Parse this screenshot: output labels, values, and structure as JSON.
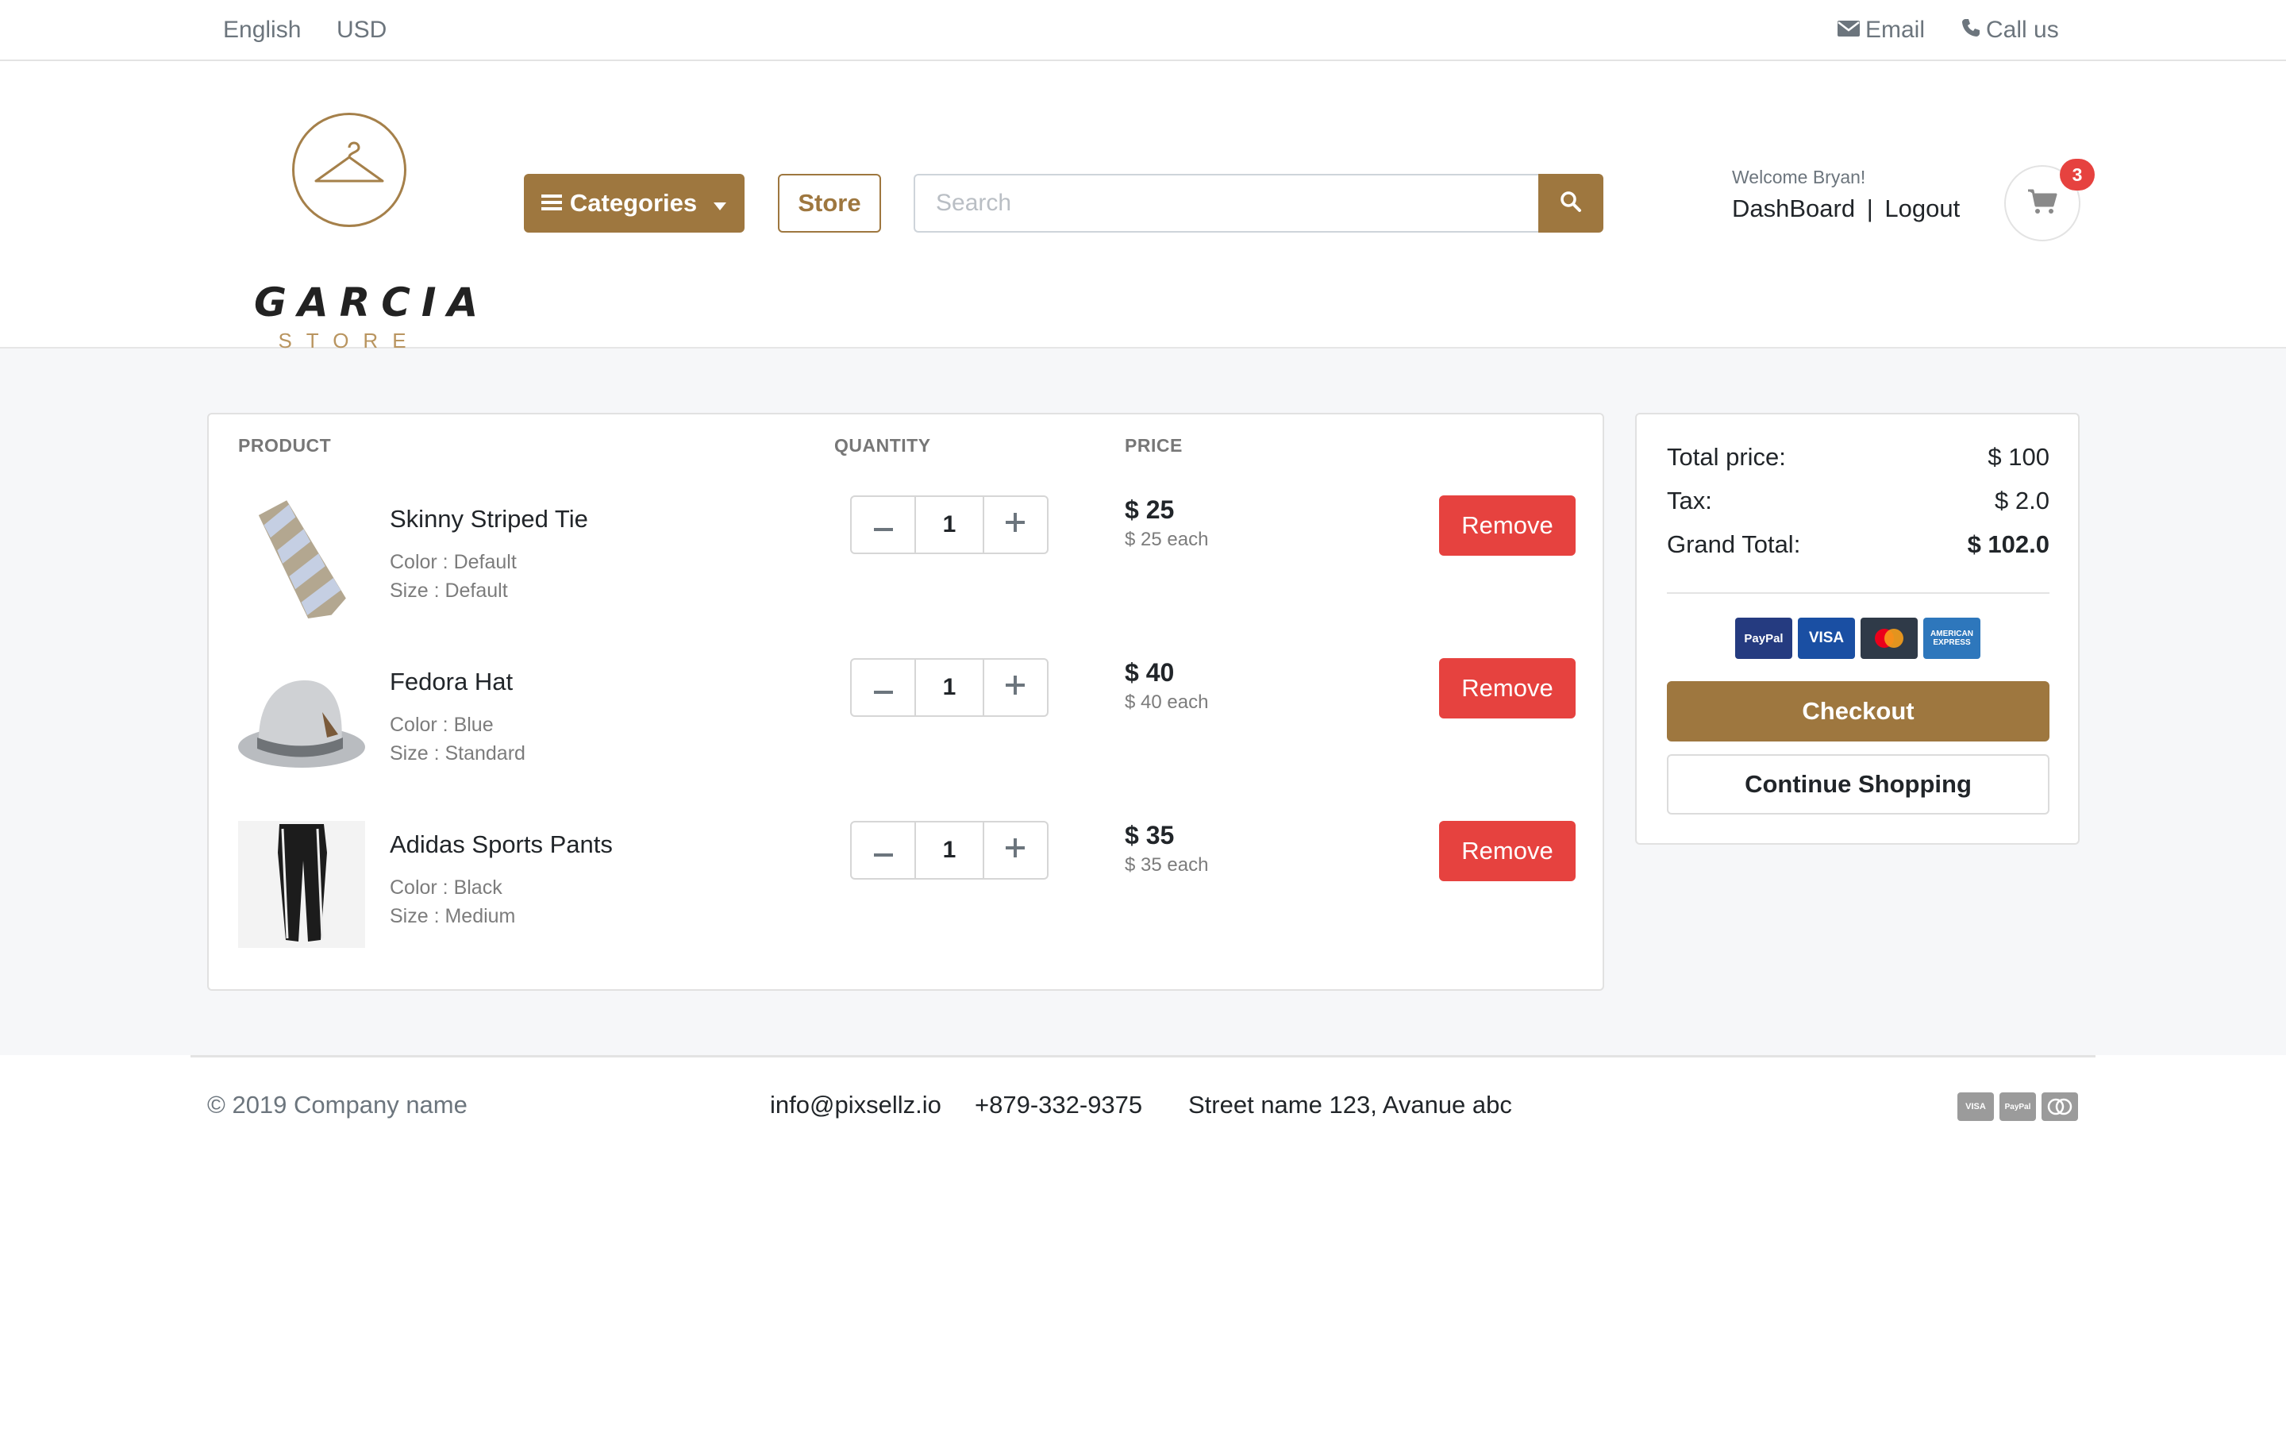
{
  "topbar": {
    "language": "English",
    "currency": "USD",
    "email_label": "Email",
    "call_label": "Call us"
  },
  "logo": {
    "word": "GARCIA",
    "sub": "STORE"
  },
  "header": {
    "categories_label": "Categories",
    "store_label": "Store",
    "search_placeholder": "Search",
    "welcome": "Welcome Bryan!",
    "dashboard_label": "DashBoard",
    "separator": "|",
    "logout_label": "Logout",
    "cart_count": "3"
  },
  "cart": {
    "headers": {
      "product": "PRODUCT",
      "quantity": "QUANTITY",
      "price": "PRICE"
    },
    "remove_label": "Remove",
    "items": [
      {
        "name": "Skinny Striped Tie",
        "color": "Color : Default",
        "size": "Size : Default",
        "qty": "1",
        "price": "$ 25",
        "each": "$ 25 each"
      },
      {
        "name": "Fedora Hat",
        "color": "Color : Blue",
        "size": "Size : Standard",
        "qty": "1",
        "price": "$ 40",
        "each": "$ 40 each"
      },
      {
        "name": "Adidas Sports Pants",
        "color": "Color : Black",
        "size": "Size : Medium",
        "qty": "1",
        "price": "$ 35",
        "each": "$ 35 each"
      }
    ]
  },
  "summary": {
    "total_label": "Total price:",
    "total_value": "$ 100",
    "tax_label": "Tax:",
    "tax_value": "$ 2.0",
    "grand_label": "Grand Total:",
    "grand_value": "$ 102.0",
    "payment_logos": [
      "PayPal",
      "VISA",
      "AMERICAN EXPRESS"
    ],
    "checkout_label": "Checkout",
    "continue_label": "Continue Shopping"
  },
  "footer": {
    "copyright": "© 2019 Company name",
    "email": "info@pixsellz.io",
    "phone": "+879-332-9375",
    "address": "Street name 123, Avanue abc",
    "payment_logos": [
      "VISA",
      "PayPal"
    ]
  },
  "colors": {
    "brand": "#9e773f",
    "danger": "#e6423f",
    "background": "#f6f7f9"
  }
}
